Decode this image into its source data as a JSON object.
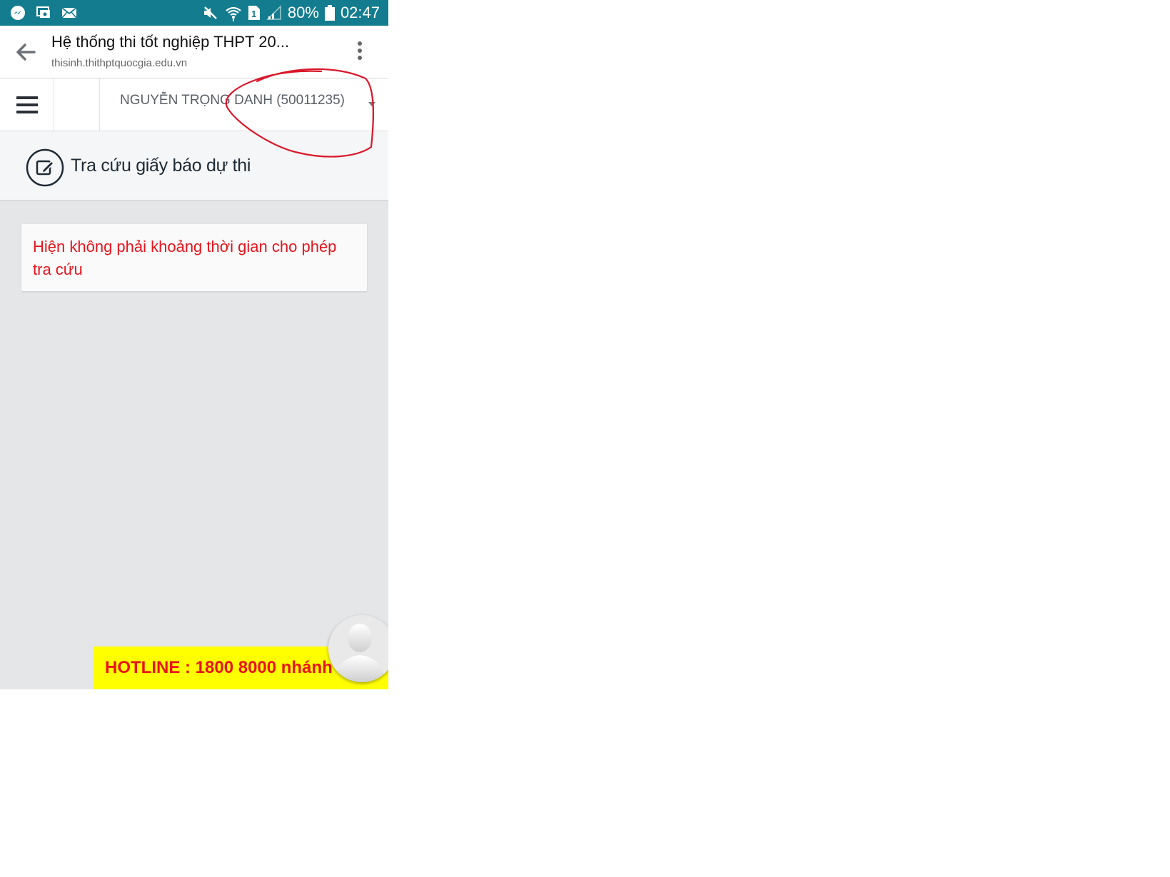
{
  "status_bar": {
    "battery": "80%",
    "time": "02:47",
    "sim_slot": "1",
    "icons": [
      "messenger-icon",
      "cast-icon",
      "mail-icon",
      "mute-icon",
      "wifi-icon",
      "sim-icon",
      "signal-icon",
      "battery-icon"
    ]
  },
  "browser": {
    "title": "Hệ thống thi tốt nghiệp THPT 20...",
    "url": "thisinh.thithptquocgia.edu.vn"
  },
  "header": {
    "user_label": "NGUYỄN TRỌNG DANH (50011235)"
  },
  "page": {
    "title": "Tra cứu giấy báo dự thi",
    "message": "Hiện không phải khoảng thời gian cho phép tra cứu"
  },
  "hotline": {
    "text": "HOTLINE : 1800 8000 nhánh"
  },
  "colors": {
    "status_bar": "#137d8f",
    "message_text": "#e8141b",
    "hotline_bg": "#ffff00",
    "annotation": "#d9182b"
  }
}
